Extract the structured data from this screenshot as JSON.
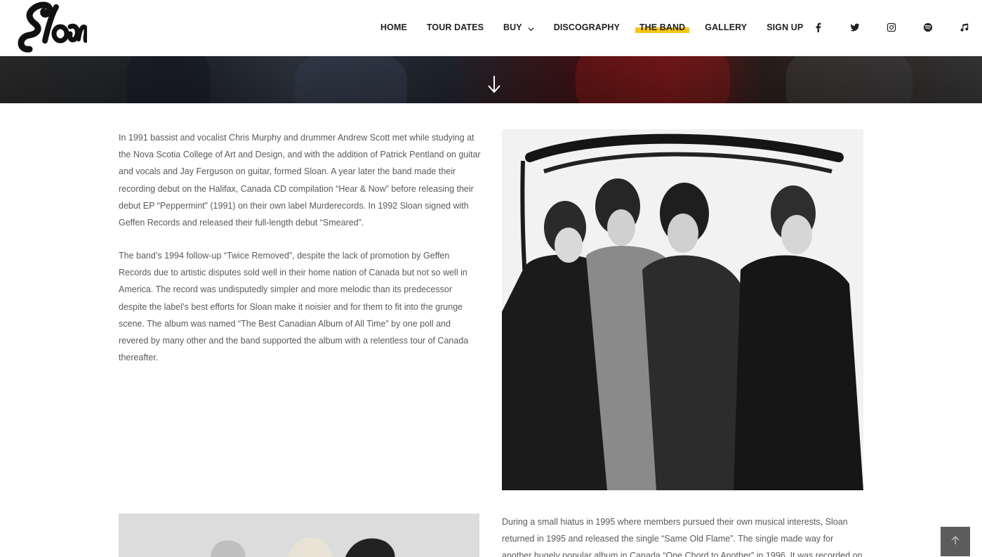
{
  "header": {
    "logo_alt": "Sloan",
    "nav": [
      {
        "label": "HOME",
        "active": false
      },
      {
        "label": "TOUR DATES",
        "active": false
      },
      {
        "label": "BUY",
        "active": false,
        "has_dropdown": true
      },
      {
        "label": "DISCOGRAPHY",
        "active": false
      },
      {
        "label": "THE BAND",
        "active": true
      },
      {
        "label": "GALLERY",
        "active": false
      },
      {
        "label": "SIGN UP",
        "active": false
      }
    ],
    "social": [
      "facebook-icon",
      "twitter-icon",
      "instagram-icon",
      "spotify-icon",
      "music-note-icon"
    ],
    "active_highlight_color": "#f5c518"
  },
  "hero": {
    "scroll_icon": "down-arrow-icon"
  },
  "content": {
    "paragraph_1": "In 1991 bassist and vocalist Chris Murphy and drummer Andrew Scott met while studying at the Nova Scotia College of Art and Design, and with the addition of Patrick Pentland on guitar and vocals and Jay Ferguson on guitar, formed Sloan. A year later the band made their recording debut on the Halifax, Canada CD compilation “Hear & Now” before releasing their debut EP “Peppermint” (1991) on their own label Murderecords. In 1992 Sloan signed with Geffen Records and released their full-length debut “Smeared”.",
    "paragraph_2": "The band’s 1994 follow-up “Twice Removed”, despite the lack of promotion by Geffen Records due to artistic disputes sold well in their home nation of Canada but not so well in America. The record was undisputedly simpler and more melodic than its predecessor despite the label’s best efforts for Sloan make it noisier and for them to fit into the grunge scene. The album was named “The Best Canadian Album of All Time” by one poll and revered by many other and the band supported the album with a relentless tour of Canada thereafter.",
    "paragraph_3": "During a small hiatus in 1995 where members pursued their own musical interests, Sloan returned in 1995 and released the single “Same Old Flame”. The single made way for another hugely popular album in Canada “One Chord to Another” in 1996. It was recorded on"
  },
  "scroll_top_icon": "chevron-up-icon"
}
